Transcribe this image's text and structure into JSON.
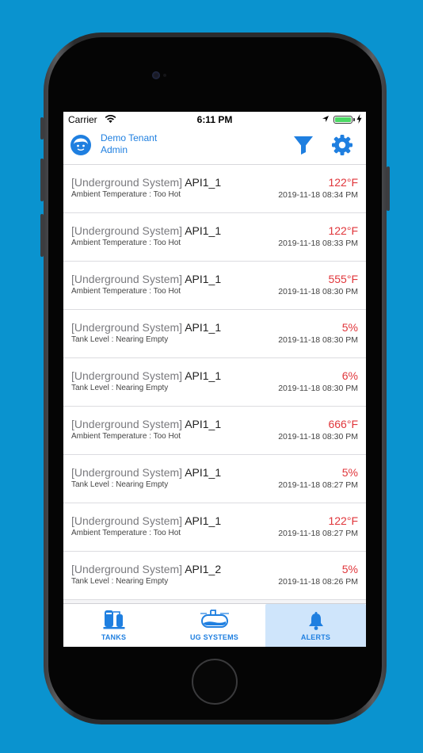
{
  "status_bar": {
    "carrier": "Carrier",
    "time": "6:11 PM"
  },
  "header": {
    "tenant_name": "Demo Tenant",
    "role": "Admin"
  },
  "alerts": [
    {
      "system": "[Underground System]",
      "name": "API1_1",
      "reason": "Ambient Temperature : Too Hot",
      "value": "122°F",
      "date": "2019-11-18 08:34 PM"
    },
    {
      "system": "[Underground System]",
      "name": "API1_1",
      "reason": "Ambient Temperature : Too Hot",
      "value": "122°F",
      "date": "2019-11-18 08:33 PM"
    },
    {
      "system": "[Underground System]",
      "name": "API1_1",
      "reason": "Ambient Temperature : Too Hot",
      "value": "555°F",
      "date": "2019-11-18 08:30 PM"
    },
    {
      "system": "[Underground System]",
      "name": "API1_1",
      "reason": "Tank Level : Nearing Empty",
      "value": "5%",
      "date": "2019-11-18 08:30 PM"
    },
    {
      "system": "[Underground System]",
      "name": "API1_1",
      "reason": "Tank Level : Nearing Empty",
      "value": "6%",
      "date": "2019-11-18 08:30 PM"
    },
    {
      "system": "[Underground System]",
      "name": "API1_1",
      "reason": "Ambient Temperature : Too Hot",
      "value": "666°F",
      "date": "2019-11-18 08:30 PM"
    },
    {
      "system": "[Underground System]",
      "name": "API1_1",
      "reason": "Tank Level : Nearing Empty",
      "value": "5%",
      "date": "2019-11-18 08:27 PM"
    },
    {
      "system": "[Underground System]",
      "name": "API1_1",
      "reason": "Ambient Temperature : Too Hot",
      "value": "122°F",
      "date": "2019-11-18 08:27 PM"
    },
    {
      "system": "[Underground System]",
      "name": "API1_2",
      "reason": "Tank Level : Nearing Empty",
      "value": "5%",
      "date": "2019-11-18 08:26 PM"
    }
  ],
  "tabs": [
    {
      "label": "TANKS",
      "icon": "tanks-icon"
    },
    {
      "label": "UG SYSTEMS",
      "icon": "ug-systems-icon"
    },
    {
      "label": "ALERTS",
      "icon": "bell-icon",
      "active": true
    }
  ],
  "colors": {
    "accent": "#1f7fe0",
    "alert_value": "#e0363b",
    "background": "#0a93cf",
    "active_tab": "#cfe5fb"
  }
}
